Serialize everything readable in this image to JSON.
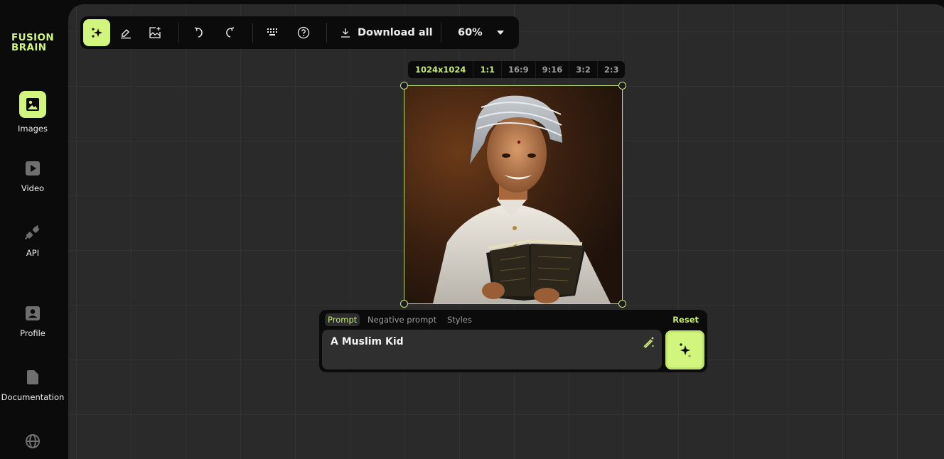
{
  "brand": {
    "logo_line1": "FUSION",
    "logo_line2": "BRAIN",
    "accent": "#d2f57d"
  },
  "sidebar": {
    "items": [
      {
        "label": "Images",
        "icon": "image-icon",
        "active": true
      },
      {
        "label": "Video",
        "icon": "play-icon"
      },
      {
        "label": "API",
        "icon": "plug-icon"
      },
      {
        "label": "Profile",
        "icon": "profile-icon"
      },
      {
        "label": "Documentation",
        "icon": "document-icon"
      },
      {
        "label": "",
        "icon": "globe-icon"
      }
    ]
  },
  "toolbar": {
    "tools": [
      {
        "name": "generate",
        "icon": "sparkle-icon",
        "active": true
      },
      {
        "name": "eraser",
        "icon": "eraser-icon"
      },
      {
        "name": "add-image",
        "icon": "add-image-icon"
      },
      {
        "name": "undo",
        "icon": "undo-icon"
      },
      {
        "name": "redo",
        "icon": "redo-icon"
      },
      {
        "name": "shortcuts",
        "icon": "keyboard-icon"
      },
      {
        "name": "help",
        "icon": "help-icon"
      }
    ],
    "download_label": "Download all",
    "zoom_value": "60%"
  },
  "ratio_bar": {
    "size": "1024x1024",
    "options": [
      "1:1",
      "16:9",
      "9:16",
      "3:2",
      "2:3"
    ],
    "selected": "1:1"
  },
  "image": {
    "description": "Smiling boy in white robe and striped head wrap holding an open book"
  },
  "prompt_panel": {
    "tabs": [
      "Prompt",
      "Negative prompt",
      "Styles"
    ],
    "active_tab": "Prompt",
    "reset_label": "Reset",
    "prompt_value": "A Muslim Kid"
  }
}
